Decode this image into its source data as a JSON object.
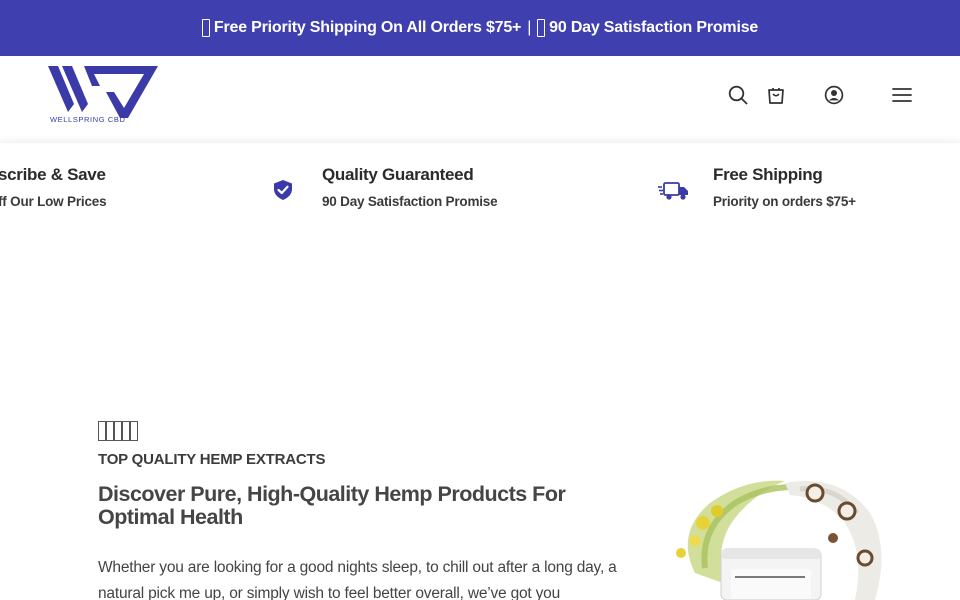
{
  "announcement": {
    "left_text": "Free Priority Shipping On All Orders $75+",
    "separator": "|",
    "right_text": "90 Day Satisfaction Promise",
    "background": "#3f3fb0"
  },
  "header": {
    "logo_text": "WELLSPRING CBD",
    "brand_color": "#3a3aa8",
    "icons": [
      "search-icon",
      "cart-icon",
      "account-icon",
      "menu-icon"
    ]
  },
  "trust_strip": {
    "items": [
      {
        "title": "scribe & Save",
        "subtitle": "ff Our Low Prices",
        "icon": "none"
      },
      {
        "title": "Quality Guaranteed",
        "subtitle": "90 Day Satisfaction Promise",
        "icon": "shield-check-icon"
      },
      {
        "title": "Free Shipping",
        "subtitle": "Priority on orders $75+",
        "icon": "delivery-truck-icon"
      }
    ]
  },
  "hero": {
    "rating_glyphs": 5,
    "eyebrow": "TOP QUALITY HEMP EXTRACTS",
    "headline": "Discover Pure, High-Quality Hemp Products For Optimal Health",
    "body": "Whether you are looking for a good nights sleep, to chill out after a long day, a natural pick me up, or simply wish to feel better overall, we’ve got you",
    "image_alt": "hemp product jar with coconut and lemon splash"
  }
}
